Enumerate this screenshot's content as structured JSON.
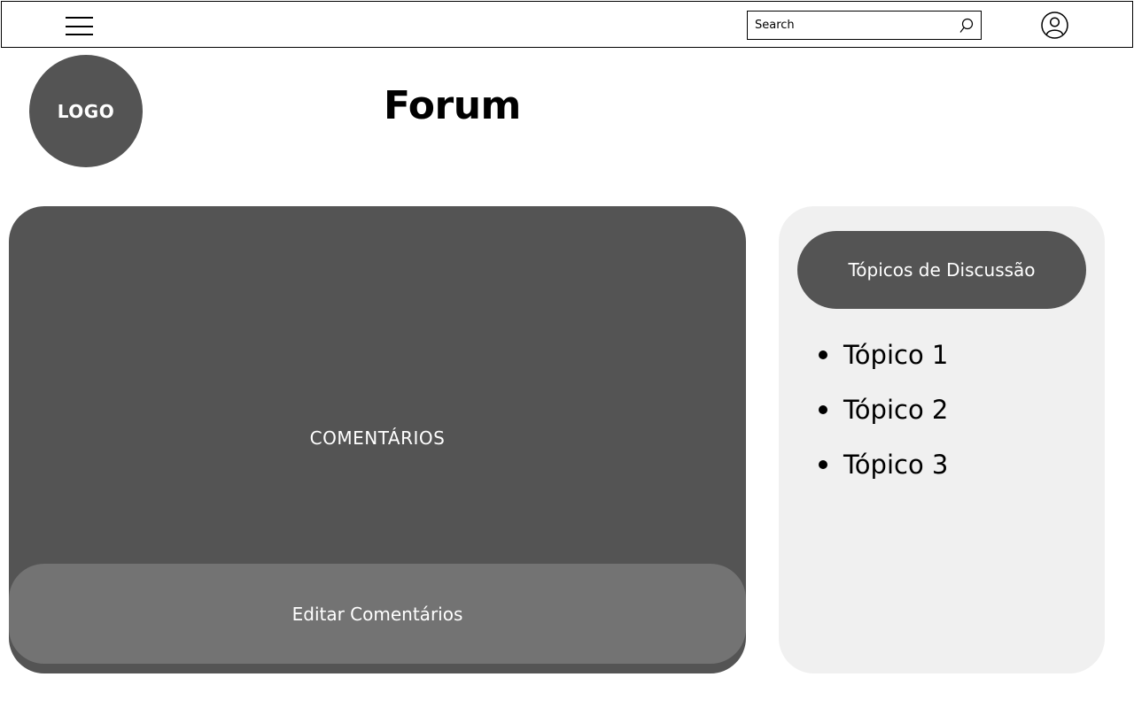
{
  "header": {
    "search_placeholder": "Search"
  },
  "logo": {
    "text": "LOGO"
  },
  "page": {
    "title": "Forum"
  },
  "comments": {
    "label": "COMENTÁRIOS",
    "edit_button": "Editar Comentários"
  },
  "topics": {
    "header": "Tópicos de Discussão",
    "items": [
      {
        "label": "Tópico 1"
      },
      {
        "label": "Tópico 2"
      },
      {
        "label": "Tópico 3"
      }
    ]
  },
  "colors": {
    "panel_dark": "#545454",
    "panel_button": "#737373",
    "panel_light": "#f0f0f0"
  }
}
